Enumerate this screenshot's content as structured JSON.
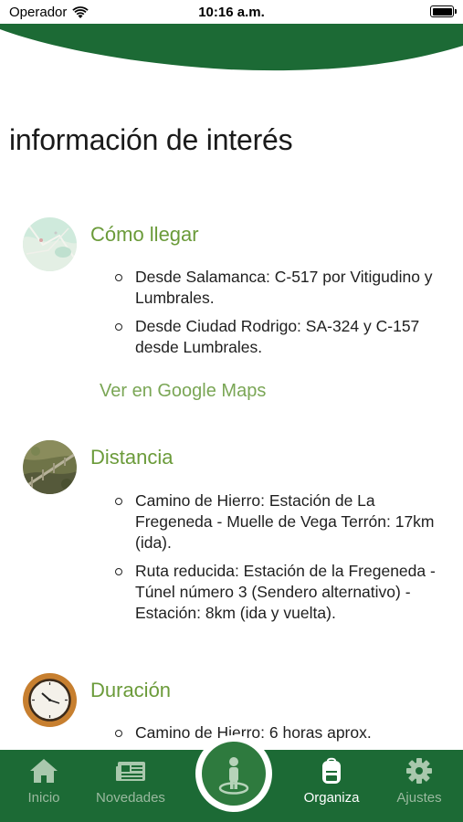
{
  "status": {
    "carrier": "Operador",
    "time": "10:16 a.m."
  },
  "page": {
    "title": "información de interés"
  },
  "sections": [
    {
      "title": "Cómo llegar",
      "items": [
        "Desde Salamanca: C-517 por Vitigudino y Lumbrales.",
        "Desde Ciudad Rodrigo: SA-324 y C-157 desde Lumbrales."
      ],
      "link": "Ver en Google Maps"
    },
    {
      "title": "Distancia",
      "items": [
        "Camino de Hierro: Estación de La Fregeneda - Muelle de Vega Terrón: 17km (ida).",
        "Ruta reducida: Estación de la Fregeneda - Túnel número 3 (Sendero alternativo) - Estación: 8km (ida y vuelta)."
      ]
    },
    {
      "title": "Duración",
      "items": [
        "Camino de Hierro: 6 horas aprox."
      ]
    }
  ],
  "tabbar": {
    "tabs": [
      {
        "label": "Inicio",
        "icon": "home-icon"
      },
      {
        "label": "Novedades",
        "icon": "newspaper-icon"
      },
      {
        "label": "Organiza",
        "icon": "backpack-icon"
      },
      {
        "label": "Ajustes",
        "icon": "gear-icon"
      }
    ],
    "center_icon": "hiker-location-icon"
  },
  "colors": {
    "primary": "#1c6a35",
    "accent": "#6b9b3a",
    "link": "#7aa655",
    "tab_inactive": "#9ab99f"
  }
}
